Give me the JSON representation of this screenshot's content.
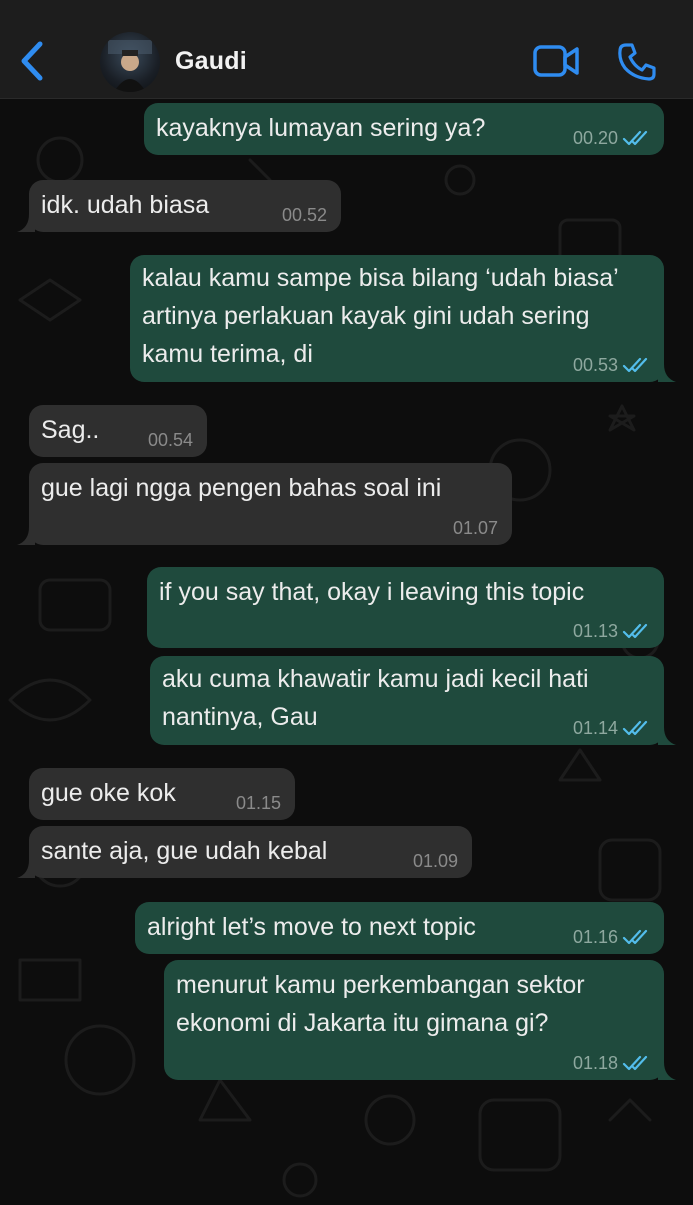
{
  "header": {
    "contact_name": "Gaudi",
    "back_icon": "chevron-left-icon",
    "video_icon": "video-camera-icon",
    "call_icon": "phone-icon",
    "accent_color": "#2f8cf0"
  },
  "colors": {
    "outgoing_bubble": "#1f4a3d",
    "incoming_bubble": "#2f2f2f",
    "read_tick": "#53bdeb"
  },
  "messages": [
    {
      "direction": "out",
      "text": "kayaknya lumayan sering ya?",
      "time": "00.20",
      "status": "read"
    },
    {
      "direction": "in",
      "text": "idk. udah biasa",
      "time": "00.52"
    },
    {
      "direction": "out",
      "text": "kalau kamu sampe bisa bilang ‘udah biasa’ artinya perlakuan kayak gini udah sering kamu terima, di",
      "time": "00.53",
      "status": "read"
    },
    {
      "direction": "in",
      "text": "Sag..",
      "time": "00.54"
    },
    {
      "direction": "in",
      "text": "gue lagi ngga pengen bahas soal ini",
      "time": "01.07"
    },
    {
      "direction": "out",
      "text": "if you say that, okay i leaving this topic",
      "time": "01.13",
      "status": "read"
    },
    {
      "direction": "out",
      "text": "aku cuma khawatir kamu jadi kecil hati nantinya, Gau",
      "time": "01.14",
      "status": "read"
    },
    {
      "direction": "in",
      "text": "gue oke kok",
      "time": "01.15"
    },
    {
      "direction": "in",
      "text": "sante aja, gue udah kebal",
      "time": "01.09"
    },
    {
      "direction": "out",
      "text": "alright let’s move to next topic",
      "time": "01.16",
      "status": "read"
    },
    {
      "direction": "out",
      "text": "menurut kamu perkembangan sektor ekonomi di Jakarta itu gimana gi?",
      "time": "01.18",
      "status": "read"
    }
  ]
}
